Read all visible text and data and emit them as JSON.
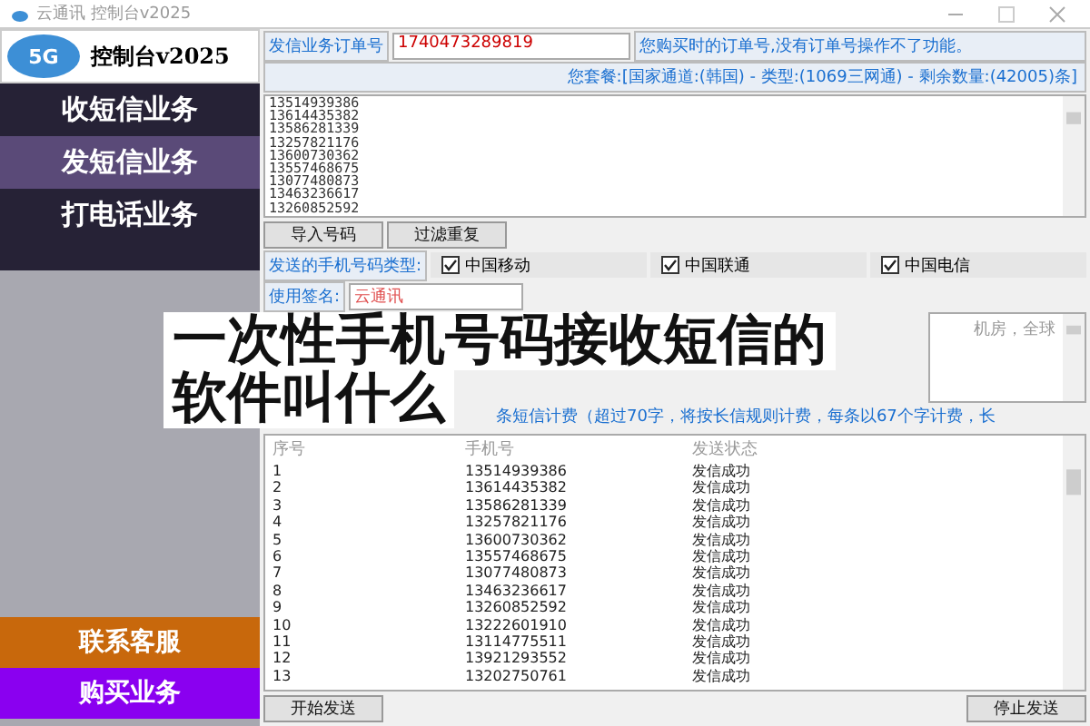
{
  "window": {
    "title": "云通讯 控制台v2025"
  },
  "sidebar": {
    "logo_badge": "5G",
    "logo_title": "控制台v2025",
    "items": [
      {
        "label": "收短信业务",
        "selected": false
      },
      {
        "label": "发短信业务",
        "selected": true
      },
      {
        "label": "打电话业务",
        "selected": false
      }
    ],
    "bottom_items": [
      {
        "label": "联系客服",
        "color": "#c8680c"
      },
      {
        "label": "购买业务",
        "color": "#8a00f0"
      }
    ]
  },
  "order": {
    "label": "发信业务订单号",
    "value": "1740473289819",
    "hint": "您购买时的订单号,没有订单号操作不了功能。"
  },
  "package": "您套餐:[国家通道:(韩国) - 类型:(1069三网通) - 剩余数量:(42005)条]",
  "numbers": [
    "13514939386",
    "13614435382",
    "13586281339",
    "13257821176",
    "13600730362",
    "13557468675",
    "13077480873",
    "13463236617",
    "13260852592"
  ],
  "number_buttons": [
    "导入号码",
    "过滤重复"
  ],
  "carrier": {
    "label": "发送的手机号码类型:",
    "options": [
      {
        "label": "中国移动",
        "checked": true
      },
      {
        "label": "中国联通",
        "checked": true
      },
      {
        "label": "中国电信",
        "checked": true
      }
    ]
  },
  "signature": {
    "label": "使用签名:",
    "value": "云通讯"
  },
  "message": "机房，全球",
  "note": "条短信计费（超过70字，将按长信规则计费，每条以67个字计费，长",
  "table": {
    "columns": [
      "序号",
      "手机号",
      "发送状态"
    ],
    "rows": [
      [
        "1",
        "13514939386",
        "发信成功"
      ],
      [
        "2",
        "13614435382",
        "发信成功"
      ],
      [
        "3",
        "13586281339",
        "发信成功"
      ],
      [
        "4",
        "13257821176",
        "发信成功"
      ],
      [
        "5",
        "13600730362",
        "发信成功"
      ],
      [
        "6",
        "13557468675",
        "发信成功"
      ],
      [
        "7",
        "13077480873",
        "发信成功"
      ],
      [
        "8",
        "13463236617",
        "发信成功"
      ],
      [
        "9",
        "13260852592",
        "发信成功"
      ],
      [
        "10",
        "13222601910",
        "发信成功"
      ],
      [
        "11",
        "13114775511",
        "发信成功"
      ],
      [
        "12",
        "13921293552",
        "发信成功"
      ],
      [
        "13",
        "13202750761",
        "发信成功"
      ]
    ]
  },
  "actions": [
    "开始发送",
    "停止发送"
  ],
  "banner": [
    "一次性手机号码接收短信的",
    "软件叫什么"
  ]
}
